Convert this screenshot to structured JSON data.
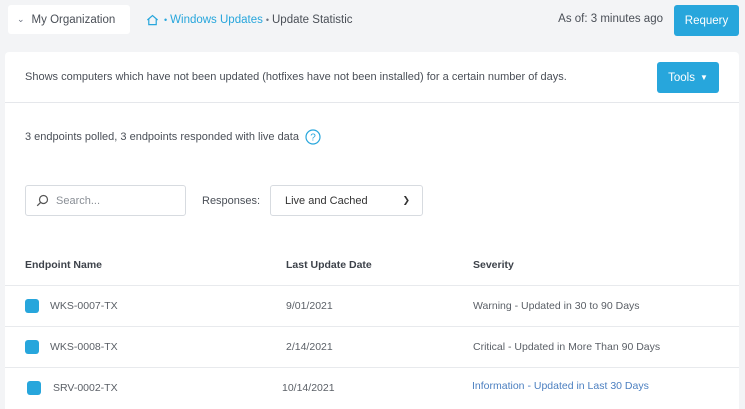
{
  "header": {
    "org_label": "My Organization",
    "breadcrumb": {
      "link_label": "Windows Updates",
      "current_label": "Update Statistic"
    },
    "as_of": "As of: 3 minutes ago",
    "requery_label": "Requery"
  },
  "panel": {
    "description": "Shows computers which have not been updated (hotfixes have not been installed) for a certain number of days.",
    "tools_label": "Tools",
    "poll_summary": "3 endpoints polled, 3 endpoints responded with live data"
  },
  "filters": {
    "search_placeholder": "Search...",
    "responses_label": "Responses:",
    "responses_value": "Live and Cached"
  },
  "table": {
    "columns": [
      "Endpoint Name",
      "Last Update Date",
      "Severity"
    ],
    "rows": [
      {
        "name": "WKS-0007-TX",
        "date": "9/01/2021",
        "severity": "Warning - Updated in 30 to 90 Days"
      },
      {
        "name": "WKS-0008-TX",
        "date": "2/14/2021",
        "severity": "Critical - Updated in More Than 90 Days"
      },
      {
        "name": "SRV-0002-TX",
        "date": "10/14/2021",
        "severity": "Information - Updated in Last 30 Days"
      }
    ]
  },
  "colors": {
    "accent": "#27a6dc",
    "info_text": "#4b7fc0"
  }
}
